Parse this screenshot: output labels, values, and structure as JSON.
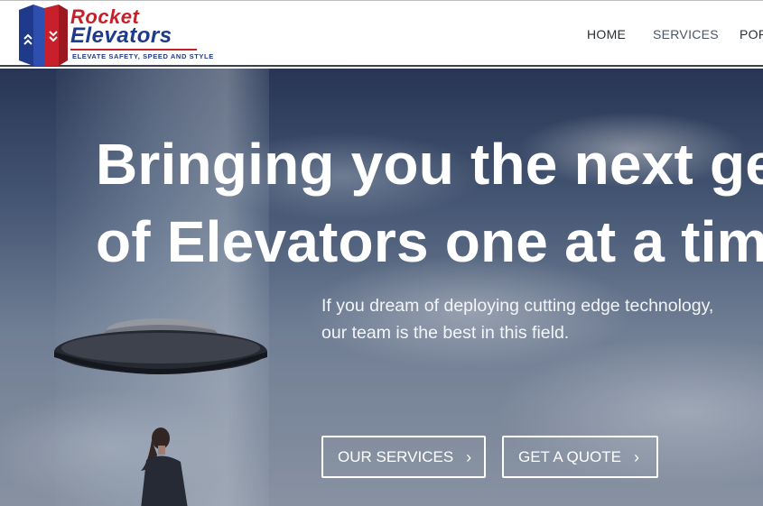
{
  "brand": {
    "name_line1": "Rocket",
    "name_line2": "Elevators",
    "tagline": "ELEVATE SAFETY, SPEED AND STYLE"
  },
  "nav": {
    "items": [
      {
        "label": "HOME",
        "active": false
      },
      {
        "label": "SERVICES",
        "active": true
      },
      {
        "label": "POR",
        "active": false
      }
    ]
  },
  "hero": {
    "headline_line1": "Bringing you the next gene",
    "headline_line2": "of Elevators one at a time",
    "subtext_line1": "If you dream of deploying cutting edge technology,",
    "subtext_line2": "our team is the best in this field.",
    "buttons": {
      "services": {
        "label": "OUR SERVICES",
        "icon": "chevron-right-icon"
      },
      "quote": {
        "label": "GET A QUOTE",
        "icon": "chevron-right-icon"
      }
    }
  },
  "colors": {
    "brand_red": "#c8202a",
    "brand_blue": "#1f3a8a",
    "nav_text": "#2a2f36",
    "header_border": "#3a3f48"
  }
}
